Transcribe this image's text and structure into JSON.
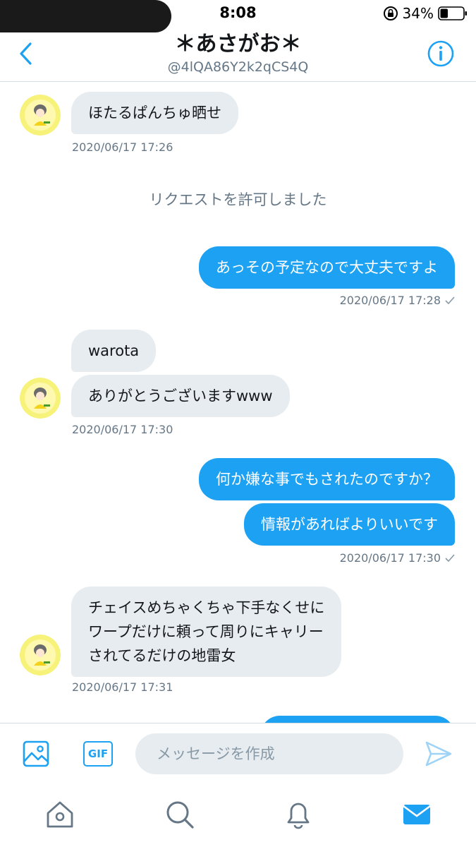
{
  "status_bar": {
    "time": "8:08",
    "battery_percent": "34%",
    "battery_level": 0.34
  },
  "header": {
    "title": "＊あさがお＊",
    "handle": "@4lQA86Y2k2qCS4Q"
  },
  "messages": {
    "m1": {
      "text": "ほたるぱんちゅ晒せ",
      "timestamp": "2020/06/17 17:26"
    },
    "system": "リクエストを許可しました",
    "m2": {
      "text": "あっその予定なので大丈夫ですよ",
      "timestamp": "2020/06/17 17:28"
    },
    "m3a": {
      "text": "warota"
    },
    "m3b": {
      "text": "ありがとうございますwww",
      "timestamp": "2020/06/17 17:30"
    },
    "m4a": {
      "text": "何か嫌な事でもされたのですか？"
    },
    "m4b": {
      "text": "情報があればよりいいです",
      "timestamp": "2020/06/17 17:30"
    },
    "m5": {
      "line1": "チェイスめちゃくちゃ下手なくせに",
      "line2": "ワープだけに頼って周りにキャリー",
      "line3": "されてるだけの地雷女",
      "timestamp": "2020/06/17 17:31"
    }
  },
  "composer": {
    "placeholder": "メッセージを作成",
    "gif_label": "GIF"
  },
  "tabbar": {
    "items": [
      "home-icon",
      "search-icon",
      "bell-icon",
      "mail-icon"
    ],
    "active": "mail-icon"
  },
  "colors": {
    "accent": "#1da1f2",
    "incoming_bubble": "#e6ecf0",
    "muted_text": "#657786"
  }
}
